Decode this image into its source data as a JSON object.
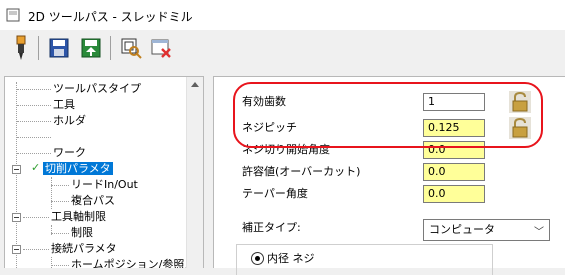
{
  "window": {
    "title": "2D ツールパス - スレッドミル"
  },
  "toolbar": {
    "buttons": [
      "tool-icon",
      "save-icon",
      "save-as-icon",
      "preview-icon",
      "delete-icon"
    ]
  },
  "tree": {
    "items": [
      {
        "label": "ツールパスタイプ"
      },
      {
        "label": "工具"
      },
      {
        "label": "ホルダ"
      },
      {
        "label": ""
      },
      {
        "label": "ワーク"
      },
      {
        "label": "切削パラメタ"
      },
      {
        "label": "リードIn/Out"
      },
      {
        "label": "複合パス"
      },
      {
        "label": "工具軸制限"
      },
      {
        "label": "制限"
      },
      {
        "label": "接続パラメタ"
      },
      {
        "label": "ホームポジション/参照点"
      }
    ]
  },
  "params": {
    "effective_teeth": {
      "label": "有効歯数",
      "value": "1"
    },
    "thread_pitch": {
      "label": "ネジピッチ",
      "value": "0.125"
    },
    "thread_start_angle": {
      "label": "ネジ切り開始角度",
      "value": "0.0"
    },
    "tolerance": {
      "label": "許容値(オーバーカット)",
      "value": "0.0"
    },
    "taper_angle": {
      "label": "テーパー角度",
      "value": "0.0"
    },
    "compensation_type": {
      "label": "補正タイプ:",
      "value": "コンピュータ"
    },
    "thread_mode": {
      "label": "内径 ネジ"
    }
  },
  "colors": {
    "selection": "#0078d7",
    "highlight_field": "#ffff99",
    "annotation": "#e8141c"
  }
}
